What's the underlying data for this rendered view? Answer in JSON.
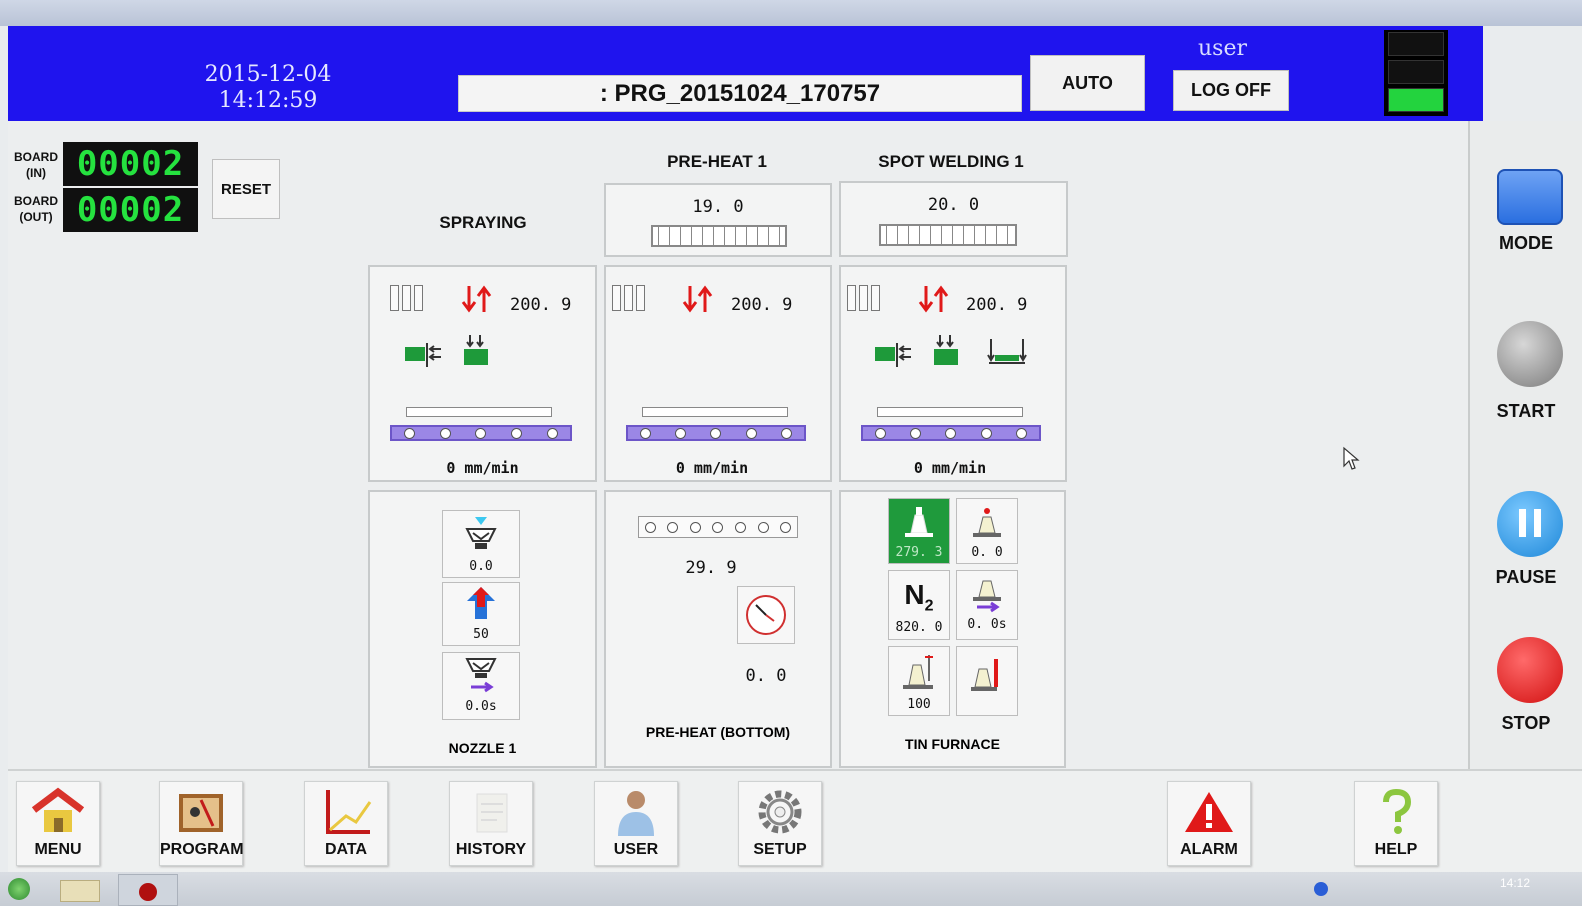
{
  "header": {
    "date": "2015-12-04",
    "time": "14:12:59",
    "program": ": PRG_20151024_170757",
    "mode_button": "AUTO",
    "user": "user",
    "logoff_button": "LOG OFF"
  },
  "counters": {
    "board_in_label_1": "BOARD",
    "board_in_label_2": "(IN)",
    "board_in_value": "00002",
    "board_out_label_1": "BOARD",
    "board_out_label_2": "(OUT)",
    "board_out_value": "00002",
    "reset_button": "RESET"
  },
  "sections": {
    "spraying": {
      "title": "SPRAYING",
      "width_value": "200. 9",
      "speed": "0 mm/min",
      "nozzle": {
        "title": "NOZZLE 1",
        "spray_value": "0.0",
        "pressure_value": "50",
        "delay_value": "0.0s"
      }
    },
    "preheat": {
      "title": "PRE-HEAT 1",
      "temp": "19. 0",
      "width_value": "200. 9",
      "speed": "0 mm/min",
      "bottom": {
        "title": "PRE-HEAT (BOTTOM)",
        "temp": "29. 9",
        "timer": "0. 0"
      }
    },
    "spot": {
      "title": "SPOT WELDING 1",
      "temp": "20. 0",
      "width_value": "200. 9",
      "speed": "0 mm/min",
      "furnace": {
        "title": "TIN FURNACE",
        "temp_value": "279. 3",
        "wave_value": "0. 0",
        "n2_label": "N",
        "n2_sub": "2",
        "n2_value": "820. 0",
        "delay_value": "0. 0s",
        "level_value": "100"
      }
    }
  },
  "right_buttons": {
    "mode": "MODE",
    "start": "START",
    "pause": "PAUSE",
    "stop": "STOP"
  },
  "nav": {
    "menu": "MENU",
    "program": "PROGRAM",
    "data": "DATA",
    "history": "HISTORY",
    "user": "USER",
    "setup": "SETUP",
    "alarm": "ALARM",
    "help": "HELP"
  },
  "taskbar": {
    "clock": "14:12"
  },
  "colors": {
    "header_bg": "#1f14ee",
    "counter_digits": "#25e23f",
    "conveyor": "#9b87e6",
    "furnace_active": "#1f9a3c",
    "stop": "#e61d1d",
    "pause": "#2a9be8",
    "mode": "#2a6fe0"
  }
}
